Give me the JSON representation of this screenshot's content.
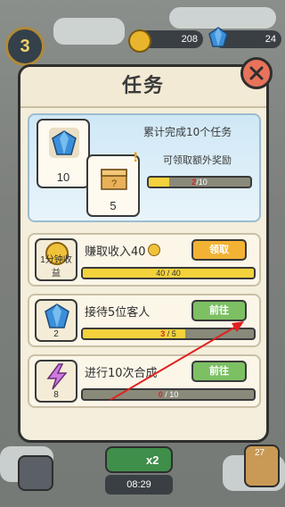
{
  "hud": {
    "level": "3",
    "coins": "208",
    "gems": "24"
  },
  "dialog": {
    "title": "任务",
    "banner": {
      "gem_reward": "10",
      "box_reward": "5",
      "title": "累计完成10个任务",
      "subtitle": "可领取额外奖励",
      "progress_current": "2",
      "progress_total": "/10",
      "progress_fraction": 0.2
    },
    "tasks": [
      {
        "icon": "gold-coin-icon",
        "icon_label": "1分钟收益",
        "title": "赚取收入40",
        "button": "领取",
        "progress_current": "40",
        "progress_total": " / 40",
        "progress_fraction": 1.0
      },
      {
        "icon": "blue-gem-icon",
        "icon_label": "2",
        "title": "接待5位客人",
        "button": "前往",
        "progress_current": "3",
        "progress_total": " / 5",
        "progress_fraction": 0.6
      },
      {
        "icon": "purple-lightning-icon",
        "icon_label": "8",
        "title": "进行10次合成",
        "button": "前往",
        "progress_current": "0",
        "progress_total": " / 10",
        "progress_fraction": 0.0
      }
    ]
  },
  "bottom": {
    "timer": "08:29",
    "multiplier": "x2",
    "badge": "27"
  },
  "colors": {
    "accent_yellow": "#f3d23b",
    "button_green": "#7cc063",
    "button_orange": "#f2b233",
    "close_red": "#e8735a",
    "annotation_red": "#e02020"
  }
}
